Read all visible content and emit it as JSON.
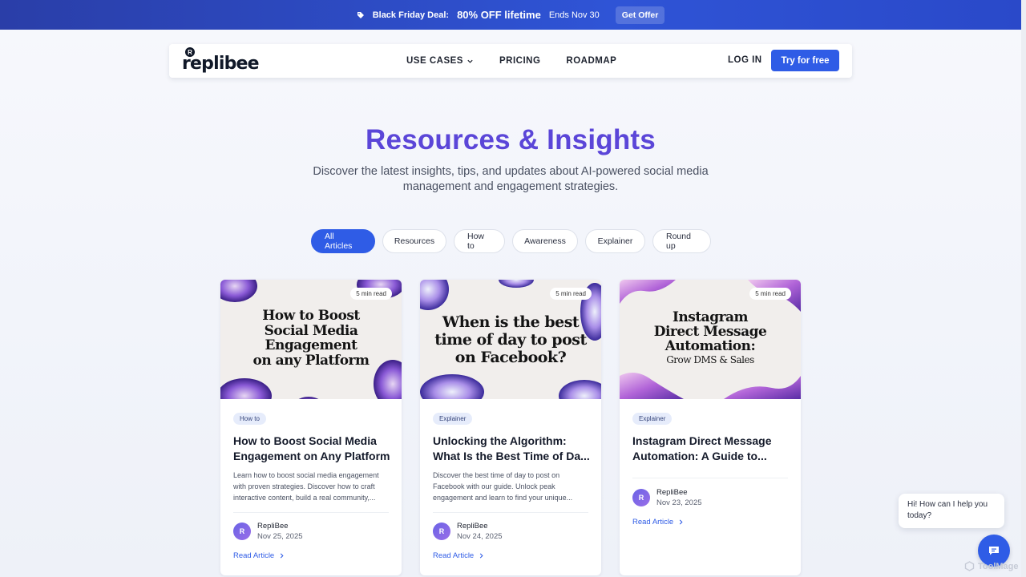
{
  "promo": {
    "deal_label": "Black Friday Deal:",
    "headline": "80% OFF lifetime",
    "ends": "Ends Nov 30",
    "cta": "Get Offer"
  },
  "nav": {
    "logo_text": "replibee",
    "logo_badge": "R",
    "links": [
      {
        "label": "USE CASES"
      },
      {
        "label": "PRICING"
      },
      {
        "label": "ROADMAP"
      }
    ],
    "login": "LOG IN",
    "try_free": "Try for free"
  },
  "hero": {
    "title": "Resources & Insights",
    "subtitle": "Discover the latest insights, tips, and updates about AI-powered social media management and engagement strategies."
  },
  "filters": [
    {
      "label": "All Articles",
      "active": true
    },
    {
      "label": "Resources",
      "active": false
    },
    {
      "label": "How to",
      "active": false
    },
    {
      "label": "Awareness",
      "active": false
    },
    {
      "label": "Explainer",
      "active": false
    },
    {
      "label": "Round up",
      "active": false
    }
  ],
  "cards": [
    {
      "thumb_lines": [
        "How to Boost",
        "Social Media",
        "Engagement",
        "on any Platform"
      ],
      "read_time": "5 min read",
      "category": "How to",
      "title": "How to Boost Social Media Engagement on Any Platform",
      "excerpt": "Learn how to boost social media engagement with proven strategies. Discover how to craft interactive content, build a real community,...",
      "author_initial": "R",
      "author": "RepliBee",
      "date": "Nov 25, 2025",
      "link": "Read Article"
    },
    {
      "thumb_lines": [
        "When is the best",
        "time of day to post",
        "on Facebook?"
      ],
      "read_time": "5 min read",
      "category": "Explainer",
      "title": "Unlocking the Algorithm: What Is the Best Time of Da...",
      "excerpt": "Discover the best time of day to post on Facebook with our guide. Unlock peak engagement and learn to find your unique...",
      "author_initial": "R",
      "author": "RepliBee",
      "date": "Nov 24, 2025",
      "link": "Read Article"
    },
    {
      "thumb_lines": [
        "Instagram",
        "Direct Message",
        "Automation:",
        "Grow DMS & Sales"
      ],
      "read_time": "5 min read",
      "category": "Explainer",
      "title": "Instagram Direct Message Automation: A Guide to...",
      "excerpt": "",
      "author_initial": "R",
      "author": "RepliBee",
      "date": "Nov 23, 2025",
      "link": "Read Article"
    }
  ],
  "chat": {
    "greeting": "Hi! How can I help you today?"
  },
  "watermark": "ToolMage",
  "colors": {
    "accent": "#2f5ce6",
    "title_purple": "#5b46d8",
    "promo_bg": "#2a3ea8"
  }
}
